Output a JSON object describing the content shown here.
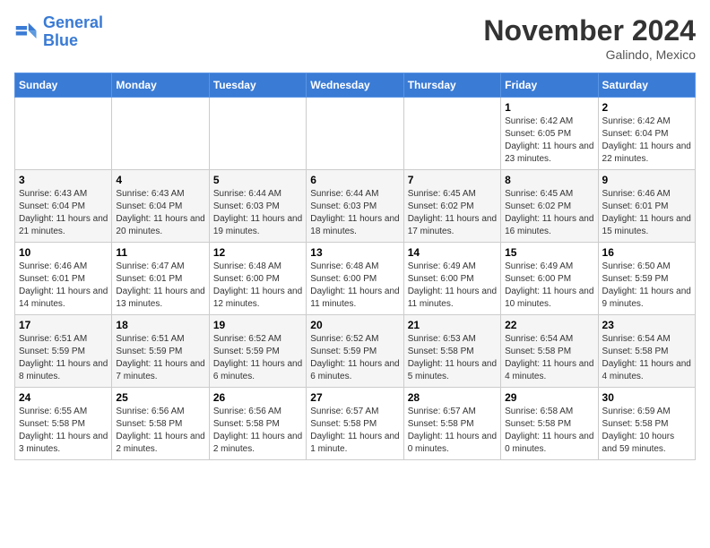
{
  "header": {
    "logo_line1": "General",
    "logo_line2": "Blue",
    "month": "November 2024",
    "location": "Galindo, Mexico"
  },
  "days_of_week": [
    "Sunday",
    "Monday",
    "Tuesday",
    "Wednesday",
    "Thursday",
    "Friday",
    "Saturday"
  ],
  "weeks": [
    [
      {
        "day": "",
        "info": ""
      },
      {
        "day": "",
        "info": ""
      },
      {
        "day": "",
        "info": ""
      },
      {
        "day": "",
        "info": ""
      },
      {
        "day": "",
        "info": ""
      },
      {
        "day": "1",
        "info": "Sunrise: 6:42 AM\nSunset: 6:05 PM\nDaylight: 11 hours and 23 minutes."
      },
      {
        "day": "2",
        "info": "Sunrise: 6:42 AM\nSunset: 6:04 PM\nDaylight: 11 hours and 22 minutes."
      }
    ],
    [
      {
        "day": "3",
        "info": "Sunrise: 6:43 AM\nSunset: 6:04 PM\nDaylight: 11 hours and 21 minutes."
      },
      {
        "day": "4",
        "info": "Sunrise: 6:43 AM\nSunset: 6:04 PM\nDaylight: 11 hours and 20 minutes."
      },
      {
        "day": "5",
        "info": "Sunrise: 6:44 AM\nSunset: 6:03 PM\nDaylight: 11 hours and 19 minutes."
      },
      {
        "day": "6",
        "info": "Sunrise: 6:44 AM\nSunset: 6:03 PM\nDaylight: 11 hours and 18 minutes."
      },
      {
        "day": "7",
        "info": "Sunrise: 6:45 AM\nSunset: 6:02 PM\nDaylight: 11 hours and 17 minutes."
      },
      {
        "day": "8",
        "info": "Sunrise: 6:45 AM\nSunset: 6:02 PM\nDaylight: 11 hours and 16 minutes."
      },
      {
        "day": "9",
        "info": "Sunrise: 6:46 AM\nSunset: 6:01 PM\nDaylight: 11 hours and 15 minutes."
      }
    ],
    [
      {
        "day": "10",
        "info": "Sunrise: 6:46 AM\nSunset: 6:01 PM\nDaylight: 11 hours and 14 minutes."
      },
      {
        "day": "11",
        "info": "Sunrise: 6:47 AM\nSunset: 6:01 PM\nDaylight: 11 hours and 13 minutes."
      },
      {
        "day": "12",
        "info": "Sunrise: 6:48 AM\nSunset: 6:00 PM\nDaylight: 11 hours and 12 minutes."
      },
      {
        "day": "13",
        "info": "Sunrise: 6:48 AM\nSunset: 6:00 PM\nDaylight: 11 hours and 11 minutes."
      },
      {
        "day": "14",
        "info": "Sunrise: 6:49 AM\nSunset: 6:00 PM\nDaylight: 11 hours and 11 minutes."
      },
      {
        "day": "15",
        "info": "Sunrise: 6:49 AM\nSunset: 6:00 PM\nDaylight: 11 hours and 10 minutes."
      },
      {
        "day": "16",
        "info": "Sunrise: 6:50 AM\nSunset: 5:59 PM\nDaylight: 11 hours and 9 minutes."
      }
    ],
    [
      {
        "day": "17",
        "info": "Sunrise: 6:51 AM\nSunset: 5:59 PM\nDaylight: 11 hours and 8 minutes."
      },
      {
        "day": "18",
        "info": "Sunrise: 6:51 AM\nSunset: 5:59 PM\nDaylight: 11 hours and 7 minutes."
      },
      {
        "day": "19",
        "info": "Sunrise: 6:52 AM\nSunset: 5:59 PM\nDaylight: 11 hours and 6 minutes."
      },
      {
        "day": "20",
        "info": "Sunrise: 6:52 AM\nSunset: 5:59 PM\nDaylight: 11 hours and 6 minutes."
      },
      {
        "day": "21",
        "info": "Sunrise: 6:53 AM\nSunset: 5:58 PM\nDaylight: 11 hours and 5 minutes."
      },
      {
        "day": "22",
        "info": "Sunrise: 6:54 AM\nSunset: 5:58 PM\nDaylight: 11 hours and 4 minutes."
      },
      {
        "day": "23",
        "info": "Sunrise: 6:54 AM\nSunset: 5:58 PM\nDaylight: 11 hours and 4 minutes."
      }
    ],
    [
      {
        "day": "24",
        "info": "Sunrise: 6:55 AM\nSunset: 5:58 PM\nDaylight: 11 hours and 3 minutes."
      },
      {
        "day": "25",
        "info": "Sunrise: 6:56 AM\nSunset: 5:58 PM\nDaylight: 11 hours and 2 minutes."
      },
      {
        "day": "26",
        "info": "Sunrise: 6:56 AM\nSunset: 5:58 PM\nDaylight: 11 hours and 2 minutes."
      },
      {
        "day": "27",
        "info": "Sunrise: 6:57 AM\nSunset: 5:58 PM\nDaylight: 11 hours and 1 minute."
      },
      {
        "day": "28",
        "info": "Sunrise: 6:57 AM\nSunset: 5:58 PM\nDaylight: 11 hours and 0 minutes."
      },
      {
        "day": "29",
        "info": "Sunrise: 6:58 AM\nSunset: 5:58 PM\nDaylight: 11 hours and 0 minutes."
      },
      {
        "day": "30",
        "info": "Sunrise: 6:59 AM\nSunset: 5:58 PM\nDaylight: 10 hours and 59 minutes."
      }
    ]
  ]
}
